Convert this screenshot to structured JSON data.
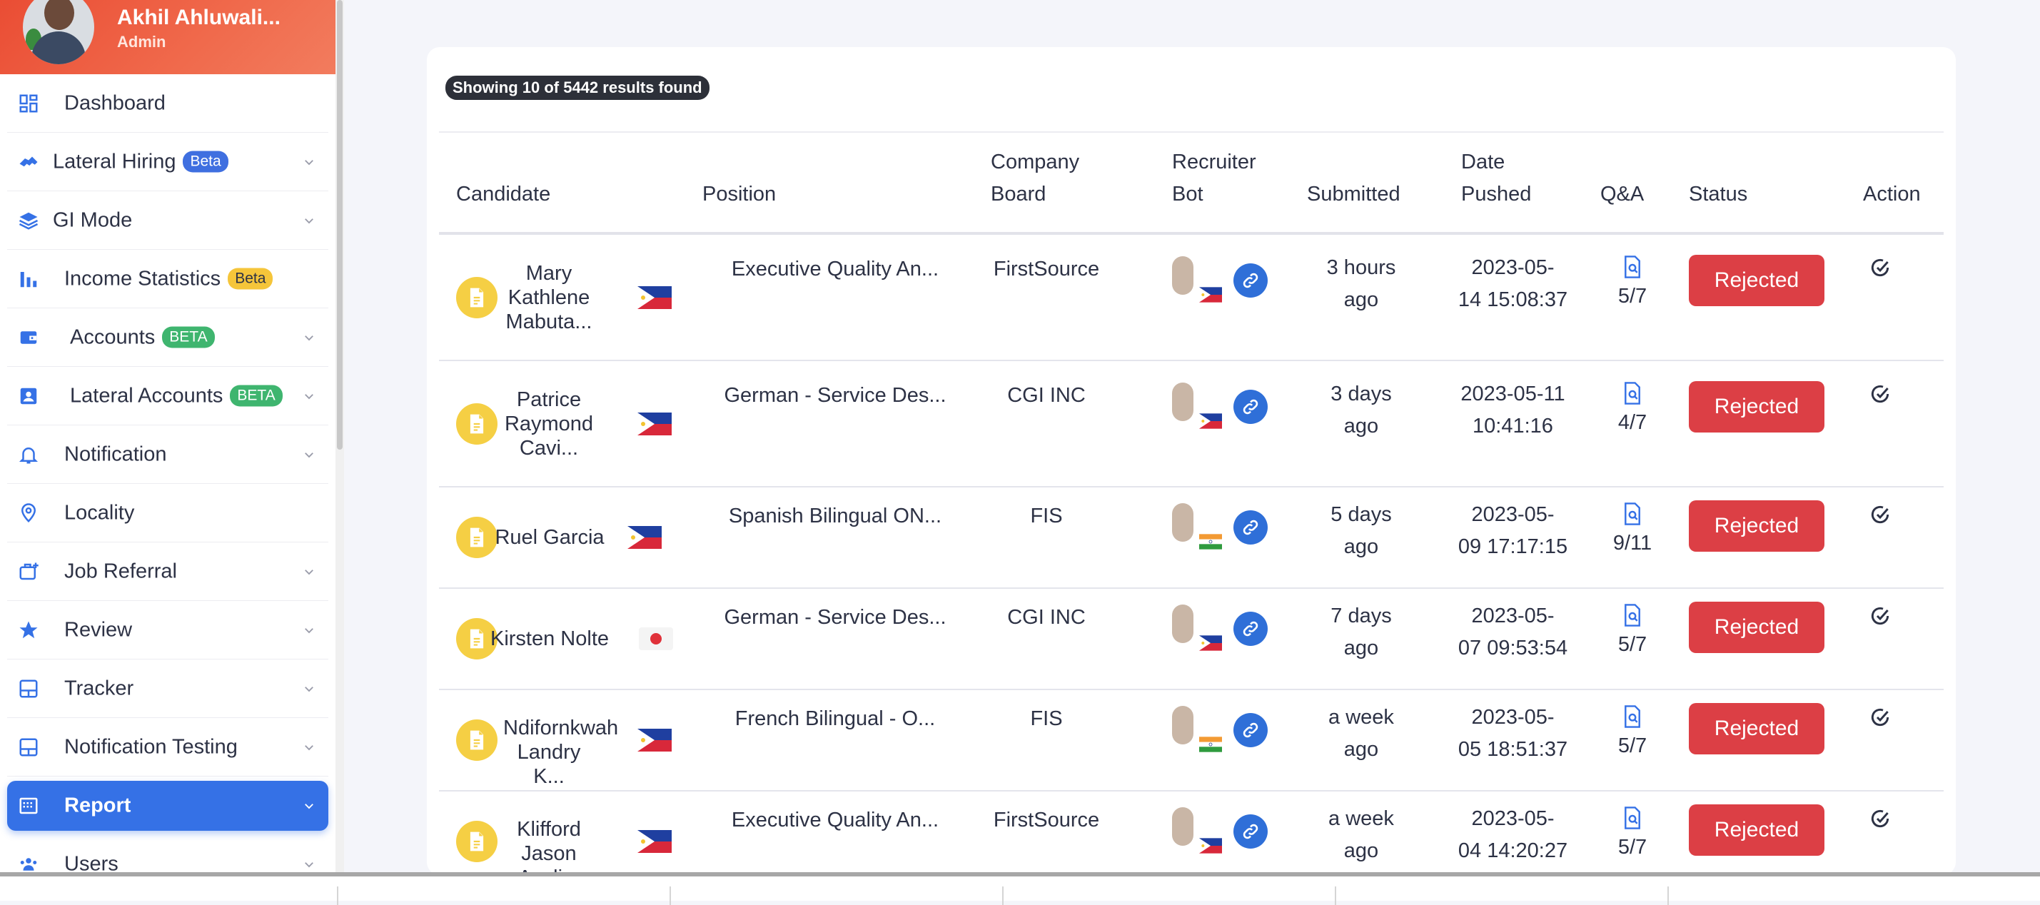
{
  "profile": {
    "name": "Akhil Ahluwali...",
    "role": "Admin"
  },
  "sidebar": {
    "items": [
      {
        "label": "Dashboard",
        "icon": "dashboard-icon",
        "badge": "",
        "chevron": false
      },
      {
        "label": "Lateral Hiring",
        "icon": "handshake-icon",
        "badge": "Beta",
        "chevron": true
      },
      {
        "label": "GI Mode",
        "icon": "layers-icon",
        "badge": "",
        "chevron": true
      },
      {
        "label": "Income Statistics",
        "icon": "bar-chart-icon",
        "badge": "Beta",
        "chevron": false
      },
      {
        "label": "Accounts",
        "icon": "wallet-icon",
        "badge": "BETA",
        "chevron": true
      },
      {
        "label": "Lateral Accounts",
        "icon": "id-card-icon",
        "badge": "BETA",
        "chevron": true
      },
      {
        "label": "Notification",
        "icon": "bell-icon",
        "badge": "",
        "chevron": true
      },
      {
        "label": "Locality",
        "icon": "location-pin-icon",
        "badge": "",
        "chevron": false
      },
      {
        "label": "Job Referral",
        "icon": "briefcase-plus-icon",
        "badge": "",
        "chevron": true
      },
      {
        "label": "Review",
        "icon": "star-icon",
        "badge": "",
        "chevron": true
      },
      {
        "label": "Tracker",
        "icon": "layout-icon",
        "badge": "",
        "chevron": true
      },
      {
        "label": "Notification Testing",
        "icon": "layout-icon",
        "badge": "",
        "chevron": true
      },
      {
        "label": "Report",
        "icon": "report-icon",
        "badge": "",
        "chevron": true,
        "active": true
      },
      {
        "label": "Users",
        "icon": "users-icon",
        "badge": "",
        "chevron": true
      }
    ]
  },
  "results_text": "Showing 10 of 5442 results found",
  "table": {
    "headers": {
      "candidate": "Candidate",
      "position": "Position",
      "company_board_1": "Company",
      "company_board_2": "Board",
      "recruiter_bot_1": "Recruiter",
      "recruiter_bot_2": "Bot",
      "submitted": "Submitted",
      "date_pushed_1": "Date",
      "date_pushed_2": "Pushed",
      "qa": "Q&A",
      "status": "Status",
      "action": "Action"
    },
    "rows": [
      {
        "name_lines": [
          "Mary",
          "Kathlene",
          "Mabuta..."
        ],
        "flag": "ph",
        "position": "Executive Quality An...",
        "company": "FirstSource",
        "bot_flag": "ph",
        "submitted": [
          "3 hours",
          "ago"
        ],
        "date": [
          "2023-05-",
          "14 15:08:37"
        ],
        "qa": "5/7",
        "status": "Rejected"
      },
      {
        "name_lines": [
          "Patrice",
          "Raymond",
          "Cavi..."
        ],
        "flag": "ph",
        "position": "German - Service Des...",
        "company": "CGI INC",
        "bot_flag": "ph",
        "submitted": [
          "3 days",
          "ago"
        ],
        "date": [
          "2023-05-11",
          "10:41:16"
        ],
        "qa": "4/7",
        "status": "Rejected"
      },
      {
        "name_lines": [
          "Ruel Garcia"
        ],
        "flag": "ph",
        "position": "Spanish Bilingual ON...",
        "company": "FIS",
        "bot_flag": "in",
        "submitted": [
          "5 days",
          "ago"
        ],
        "date": [
          "2023-05-",
          "09 17:17:15"
        ],
        "qa": "9/11",
        "status": "Rejected"
      },
      {
        "name_lines": [
          "Kirsten Nolte"
        ],
        "flag": "jp",
        "position": "German - Service Des...",
        "company": "CGI INC",
        "bot_flag": "ph",
        "submitted": [
          "7 days",
          "ago"
        ],
        "date": [
          "2023-05-",
          "07 09:53:54"
        ],
        "qa": "5/7",
        "status": "Rejected"
      },
      {
        "name_lines": [
          "Ndifornkwah",
          "Landry K..."
        ],
        "flag": "ph",
        "position": "French Bilingual - O...",
        "company": "FIS",
        "bot_flag": "in",
        "submitted": [
          "a week",
          "ago"
        ],
        "date": [
          "2023-05-",
          "05 18:51:37"
        ],
        "qa": "5/7",
        "status": "Rejected"
      },
      {
        "name_lines": [
          "Klifford",
          "Jason Aveli..."
        ],
        "flag": "ph",
        "position": "Executive Quality An...",
        "company": "FirstSource",
        "bot_flag": "ph",
        "submitted": [
          "a week",
          "ago"
        ],
        "date": [
          "2023-05-",
          "04 14:20:27"
        ],
        "qa": "5/7",
        "status": "Rejected"
      }
    ]
  },
  "colors": {
    "accent": "#3571e6",
    "rejected": "#dc3f45",
    "profile_bg": "#ea4d34",
    "doc_icon": "#f5cf44"
  }
}
